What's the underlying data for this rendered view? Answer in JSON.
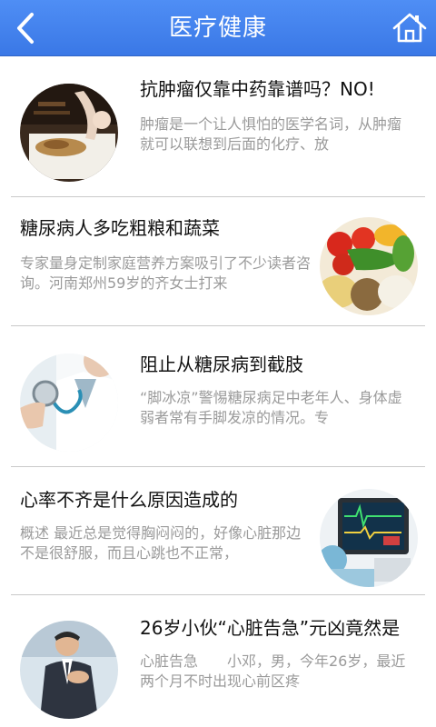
{
  "header": {
    "title": "医疗健康",
    "back_icon": "chevron-left-icon",
    "home_icon": "home-icon"
  },
  "colors": {
    "header_bg": "#4285f4",
    "divider": "#c9c9c9",
    "summary_text": "#9a9a9a"
  },
  "articles": [
    {
      "title": "抗肿瘤仅靠中药靠谱吗？NO!",
      "summary": "肿瘤是一个让人惧怕的医学名词，从肿瘤就可以联想到后面的化疗、放",
      "image": "herbal-medicine"
    },
    {
      "title": "糖尿病人多吃粗粮和蔬菜",
      "summary": "专家量身定制家庭营养方案吸引了不少读者咨询。河南郑州59岁的齐女士打来",
      "image": "vegetables-grains"
    },
    {
      "title": "阻止从糖尿病到截肢",
      "summary": "“脚冰凉”警惕糖尿病足中老年人、身体虚弱者常有手脚发凉的情况。专",
      "image": "doctor-stethoscope"
    },
    {
      "title": "心率不齐是什么原因造成的",
      "summary": "概述 最近总是觉得胸闷闷的，好像心脏那边不是很舒服，而且心跳也不正常，",
      "image": "heart-monitor"
    },
    {
      "title": "26岁小伙“心脏告急”元凶竟然是",
      "summary": "心脏告急　　小邓，男，今年26岁，最近两个月不时出现心前区疼",
      "image": "man-chest-pain"
    }
  ]
}
